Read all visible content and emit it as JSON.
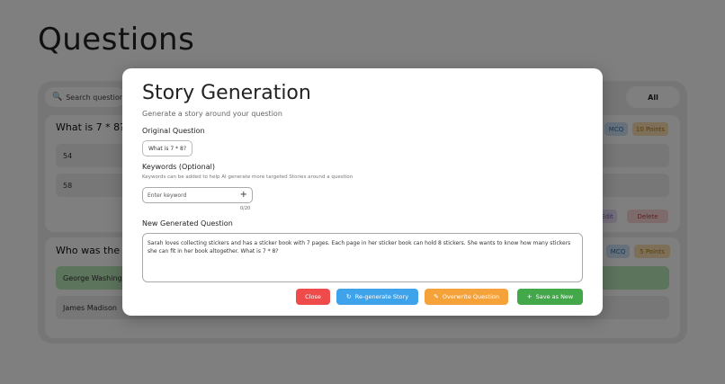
{
  "page": {
    "title": "Questions",
    "search_placeholder": "Search question",
    "filter_label": "All"
  },
  "questions": [
    {
      "text": "What is 7 * 8?",
      "type": "MCQ",
      "points": "10 Points",
      "options": [
        "54",
        "58"
      ],
      "edit_label": "Edit",
      "delete_label": "Delete"
    },
    {
      "text": "Who was the fi",
      "type": "MCQ",
      "points": "5 Points",
      "options": [
        "George Washingto",
        "James Madison"
      ]
    }
  ],
  "modal": {
    "title": "Story Generation",
    "subtitle": "Generate a story around your question",
    "original_label": "Original Question",
    "original_value": "What is 7 * 8?",
    "keywords_label": "Keywords (Optional)",
    "keywords_hint": "Keywords can be added to help AI generate more targeted Stories around a question",
    "keyword_placeholder": "Enter keyword",
    "keyword_count": "0/20",
    "generated_label": "New Generated Question",
    "generated_text": "Sarah loves collecting stickers and has a sticker book with 7 pages. Each page in her sticker book can hold 8 stickers. She wants to know how many stickers she can fit in her book altogether. What is 7 * 8?",
    "buttons": {
      "close": "Close",
      "regenerate": "Re-generate Story",
      "overwrite": "Overwrite Question",
      "save": "Save as New"
    }
  },
  "colors": {
    "close": "#ef4b4b",
    "regenerate": "#3fa3ec",
    "overwrite": "#f6a23a",
    "save": "#43a84a"
  }
}
